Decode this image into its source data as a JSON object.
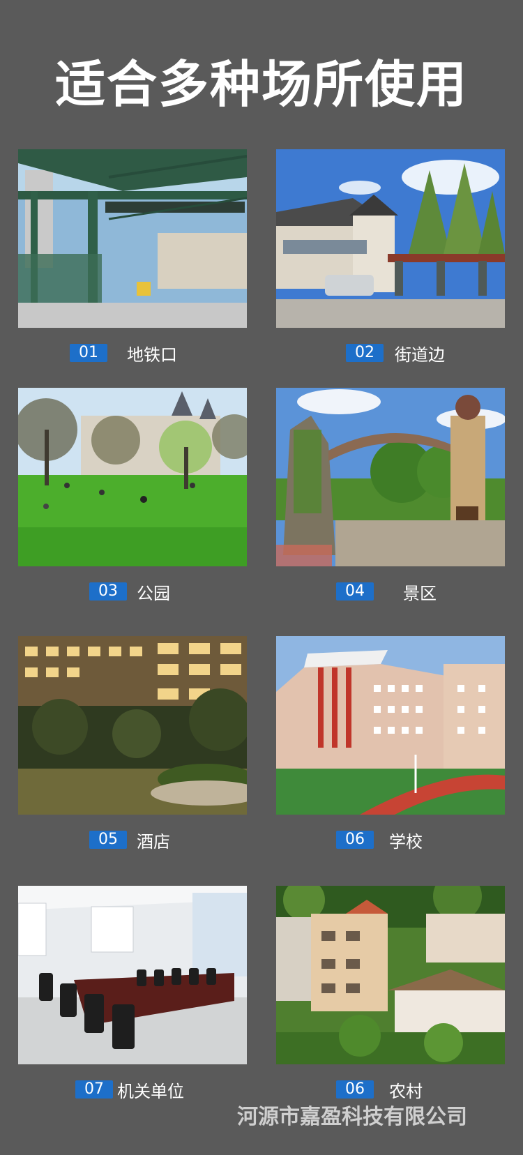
{
  "header": {
    "title": "适合多种场所使用"
  },
  "items": [
    {
      "num": "01",
      "label": "地铁口",
      "image": "subway-entrance-photo"
    },
    {
      "num": "02",
      "label": "街道边",
      "image": "street-side-photo"
    },
    {
      "num": "03",
      "label": "公园",
      "image": "park-photo"
    },
    {
      "num": "04",
      "label": "景区",
      "image": "scenic-area-gate-photo"
    },
    {
      "num": "05",
      "label": "酒店",
      "image": "hotel-night-photo"
    },
    {
      "num": "06",
      "label": "学校",
      "image": "school-building-photo"
    },
    {
      "num": "07",
      "label": "机关单位",
      "image": "meeting-room-photo"
    },
    {
      "num": "06",
      "label": "农村",
      "image": "village-houses-photo"
    }
  ],
  "footer": {
    "company": "河源市嘉盈科技有限公司"
  },
  "colors": {
    "background": "#5a5a5a",
    "badge": "#1d6fc9",
    "text": "#ffffff"
  }
}
